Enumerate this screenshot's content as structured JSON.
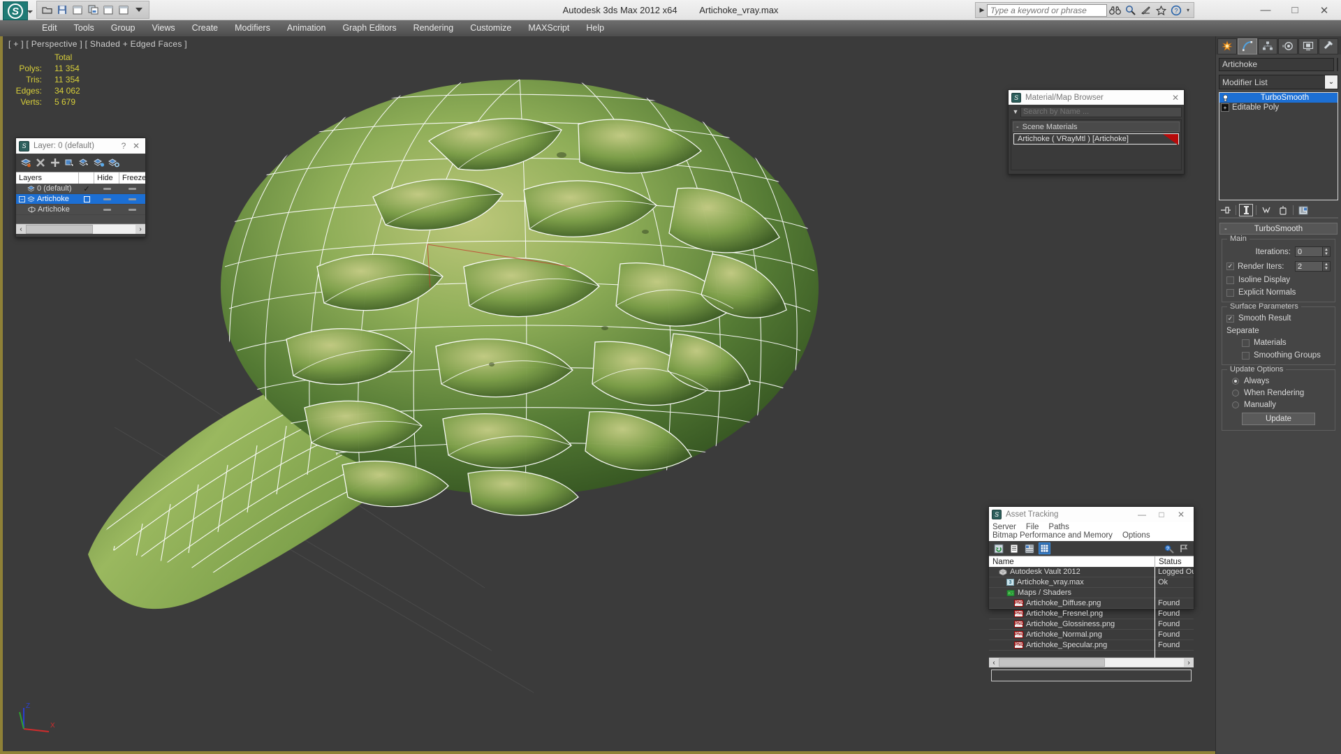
{
  "window": {
    "app_title": "Autodesk 3ds Max  2012 x64",
    "file_title": "Artichoke_vray.max",
    "minimize": "—",
    "maximize": "□",
    "close": "✕"
  },
  "quick_access": [
    {
      "name": "open-icon",
      "glyph": "📂"
    },
    {
      "name": "save-icon",
      "glyph": "💾"
    },
    {
      "name": "undo-icon",
      "glyph": "▭"
    },
    {
      "name": "redo-icon",
      "glyph": "▤"
    },
    {
      "name": "panel1-icon",
      "glyph": "▭"
    },
    {
      "name": "panel2-icon",
      "glyph": "▭"
    },
    {
      "name": "more-icon",
      "glyph": "▼"
    }
  ],
  "search": {
    "placeholder": "Type a keyword or phrase",
    "arrow": "▶",
    "icons": [
      {
        "name": "binoculars-icon",
        "glyph": "👓"
      },
      {
        "name": "magnifier-icon",
        "glyph": "🔍"
      },
      {
        "name": "satellite-icon",
        "glyph": "📡"
      },
      {
        "name": "favorite-star-icon",
        "glyph": "☆"
      },
      {
        "name": "help-icon",
        "glyph": "?"
      },
      {
        "name": "help-dropdown-icon",
        "glyph": "▾"
      }
    ]
  },
  "menu": [
    "Edit",
    "Tools",
    "Group",
    "Views",
    "Create",
    "Modifiers",
    "Animation",
    "Graph Editors",
    "Rendering",
    "Customize",
    "MAXScript",
    "Help"
  ],
  "viewport": {
    "label": "[ + ] [ Perspective ] [ Shaded + Edged Faces ]",
    "stats": {
      "header": "Total",
      "rows": [
        {
          "label": "Polys:",
          "value": "11 354"
        },
        {
          "label": "Tris:",
          "value": "11 354"
        },
        {
          "label": "Edges:",
          "value": "34 062"
        },
        {
          "label": "Verts:",
          "value": "5 679"
        }
      ]
    },
    "axis": {
      "x": "X",
      "y": "Y",
      "z": "Z"
    }
  },
  "layer_dialog": {
    "title": "Layer: 0 (default)",
    "help": "?",
    "close": "✕",
    "tools": [
      {
        "name": "new-layer-icon"
      },
      {
        "name": "delete-layer-icon"
      },
      {
        "name": "add-layer-icon"
      },
      {
        "name": "select-objects-icon"
      },
      {
        "name": "highlight-selected-icon"
      },
      {
        "name": "select-highlight-icon"
      },
      {
        "name": "layer-settings-icon"
      }
    ],
    "columns": [
      "Layers",
      "",
      "Hide",
      "Freeze"
    ],
    "rows": [
      {
        "name": "0 (default)",
        "current": "✓",
        "selected": false,
        "expand": ""
      },
      {
        "name": "Artichoke",
        "current": "",
        "selected": true,
        "expand": "−"
      },
      {
        "name": "Artichoke",
        "current": "",
        "selected": false,
        "expand": "",
        "child": true
      }
    ],
    "scroll_left": "‹",
    "scroll_right": "›"
  },
  "material_browser": {
    "title": "Material/Map Browser",
    "close": "✕",
    "search_placeholder": "Search by Name ...",
    "tri": "▼",
    "group": {
      "minus": "-",
      "label": "Scene Materials"
    },
    "material": {
      "label": "Artichoke  ( VRayMtl )  [Artichoke]",
      "swatch_color": "#b70a0a"
    }
  },
  "command_panel": {
    "tabs": [
      {
        "name": "create-tab",
        "glyph": "✳",
        "active": false
      },
      {
        "name": "modify-tab",
        "glyph": "◜",
        "active": true
      },
      {
        "name": "hierarchy-tab",
        "glyph": "⛬",
        "active": false
      },
      {
        "name": "motion-tab",
        "glyph": "◎",
        "active": false
      },
      {
        "name": "display-tab",
        "glyph": "▣",
        "active": false
      },
      {
        "name": "utilities-tab",
        "glyph": "🔨",
        "active": false
      }
    ],
    "object_name": "Artichoke",
    "object_color": "#5b9bd5",
    "modifier_list_label": "Modifier List",
    "modifier_list_caret": "⌄",
    "stack": [
      {
        "label": "TurboSmooth",
        "active": true,
        "icon": "bulb-icon"
      },
      {
        "label": "Editable Poly",
        "active": false,
        "icon": "plus-box-icon"
      }
    ],
    "stack_tools": [
      {
        "name": "pin-stack-icon",
        "glyph": "⊣",
        "boxed": false
      },
      {
        "name": "show-end-result-icon",
        "glyph": "❙",
        "boxed": true
      },
      {
        "name": "make-unique-icon",
        "glyph": "⩔",
        "boxed": false
      },
      {
        "name": "remove-modifier-icon",
        "glyph": "🗑",
        "boxed": false
      },
      {
        "name": "configure-sets-icon",
        "glyph": "▤",
        "boxed": false
      }
    ],
    "rollout": {
      "minus": "-",
      "title": "TurboSmooth",
      "main": {
        "caption": "Main",
        "iterations_label": "Iterations:",
        "iterations_value": "0",
        "render_iters_label": "Render Iters:",
        "render_iters_value": "2",
        "render_iters_checked": true,
        "isoline_label": "Isoline Display",
        "isoline_checked": false,
        "explicit_label": "Explicit Normals",
        "explicit_checked": false
      },
      "surface": {
        "caption": "Surface Parameters",
        "smooth_label": "Smooth Result",
        "smooth_checked": true,
        "separate_label": "Separate",
        "materials_label": "Materials",
        "materials_checked": false,
        "smoothing_groups_label": "Smoothing Groups",
        "smoothing_groups_checked": false
      },
      "update": {
        "caption": "Update Options",
        "options": [
          {
            "label": "Always",
            "selected": true
          },
          {
            "label": "When Rendering",
            "selected": false
          },
          {
            "label": "Manually",
            "selected": false
          }
        ],
        "button": "Update"
      }
    }
  },
  "asset_tracking": {
    "title": "Asset Tracking",
    "minimize": "—",
    "maximize": "□",
    "close": "✕",
    "menus_row1": [
      "Server",
      "File",
      "Paths"
    ],
    "menus_row2": [
      "Bitmap Performance and Memory",
      "Options"
    ],
    "toolbar": [
      {
        "name": "refresh-icon",
        "glyph": "⟳",
        "active": false
      },
      {
        "name": "list-view-icon",
        "glyph": "☰",
        "active": false
      },
      {
        "name": "detail-view-icon",
        "glyph": "▤",
        "active": false
      },
      {
        "name": "grid-view-icon",
        "glyph": "▦",
        "active": true
      },
      {
        "name": "check-in-icon",
        "glyph": "⚙",
        "active": false
      },
      {
        "name": "check-out-icon",
        "glyph": "⚑",
        "active": false
      }
    ],
    "columns": [
      "Name",
      "Status"
    ],
    "rows": [
      {
        "name": "Autodesk Vault 2012",
        "status": "Logged Ou",
        "indent": 1,
        "icon": "vault-icon"
      },
      {
        "name": "Artichoke_vray.max",
        "status": "Ok",
        "indent": 2,
        "icon": "max-file-icon"
      },
      {
        "name": "Maps / Shaders",
        "status": "",
        "indent": 2,
        "icon": "maps-icon"
      },
      {
        "name": "Artichoke_Diffuse.png",
        "status": "Found",
        "indent": 3,
        "icon": "png-icon"
      },
      {
        "name": "Artichoke_Fresnel.png",
        "status": "Found",
        "indent": 3,
        "icon": "png-icon"
      },
      {
        "name": "Artichoke_Glossiness.png",
        "status": "Found",
        "indent": 3,
        "icon": "png-icon"
      },
      {
        "name": "Artichoke_Normal.png",
        "status": "Found",
        "indent": 3,
        "icon": "png-icon"
      },
      {
        "name": "Artichoke_Specular.png",
        "status": "Found",
        "indent": 3,
        "icon": "png-icon"
      }
    ],
    "scroll_left": "‹",
    "scroll_right": "›"
  }
}
